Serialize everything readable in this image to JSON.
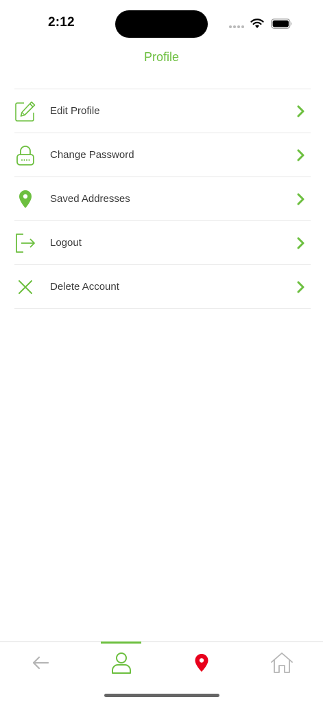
{
  "status_bar": {
    "time": "2:12"
  },
  "header": {
    "title": "Profile"
  },
  "menu": {
    "items": [
      {
        "label": "Edit Profile",
        "icon": "edit-icon"
      },
      {
        "label": "Change Password",
        "icon": "lock-icon"
      },
      {
        "label": "Saved Addresses",
        "icon": "location-pin-icon"
      },
      {
        "label": "Logout",
        "icon": "logout-icon"
      },
      {
        "label": "Delete Account",
        "icon": "close-icon"
      }
    ]
  },
  "bottom_nav": {
    "items": [
      {
        "icon": "back-arrow-icon",
        "active": false
      },
      {
        "icon": "person-icon",
        "active": true
      },
      {
        "icon": "location-pin-icon",
        "active": false
      },
      {
        "icon": "home-icon",
        "active": false
      }
    ]
  },
  "colors": {
    "accent": "#6cbf3f",
    "pin_red": "#e8001c",
    "inactive": "#b5b5b5",
    "text": "#3a3a3a",
    "divider": "#e6e6e6"
  }
}
